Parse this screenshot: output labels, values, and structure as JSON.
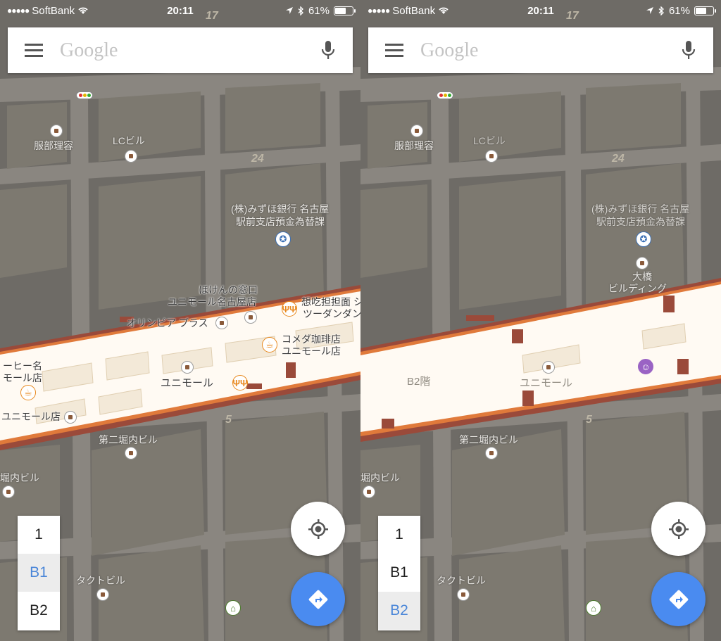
{
  "status_bar": {
    "carrier": "SoftBank",
    "time": "20:11",
    "battery": "61%",
    "battery_level": 0.61
  },
  "search": {
    "placeholder": "Google"
  },
  "colors": {
    "active_floor": "#4a86d8",
    "directions_fab": "#4a8bf0",
    "map_block": "#6e6b66",
    "building": "#7d7970",
    "road": "#8a8680",
    "mall_floor": "#fffaf3",
    "mall_border": "#e07a3b"
  },
  "screens": [
    {
      "floors": [
        "1",
        "B1",
        "B2"
      ],
      "active_floor": "B1",
      "labels": {
        "barber": "服部理容",
        "lc_building": "LCビル",
        "num_24": "24",
        "num_17": "17",
        "num_5": "5",
        "mizuho_line1": "(株)みずほ銀行 名古屋",
        "mizuho_line2": "駅前支店預金為替課",
        "hoken_line1": "ほけんの窓口",
        "hoken_line2": "ユニモール名古屋店",
        "olympia": "オリンピア プラス",
        "tantan_line1": "想吃担担面 シ",
        "tantan_line2": "ツーダンダン",
        "komeda_line1": "コメダ珈琲店",
        "komeda_line2": "ユニモール店",
        "coffee_line1": "ーヒー名",
        "coffee_line2": "モール店",
        "unimall_store": "ユニモール店",
        "unimall": "ユニモール",
        "horiuchi2": "第二堀内ビル",
        "horiuchi": "堀内ビル",
        "tact": "タクトビル"
      }
    },
    {
      "floors": [
        "1",
        "B1",
        "B2"
      ],
      "active_floor": "B2",
      "labels": {
        "barber": "服部理容",
        "lc_building": "LCビル",
        "num_24": "24",
        "num_17": "17",
        "num_5": "5",
        "mizuho_line1": "(株)みずほ銀行 名古屋",
        "mizuho_line2": "駅前支店預金為替課",
        "ohashi_line1": "大橋",
        "ohashi_line2": "ビルディング",
        "b2_floor": "B2階",
        "unimall": "ユニモール",
        "horiuchi2": "第二堀内ビル",
        "horiuchi": "堀内ビル",
        "tact": "タクトビル"
      }
    }
  ]
}
